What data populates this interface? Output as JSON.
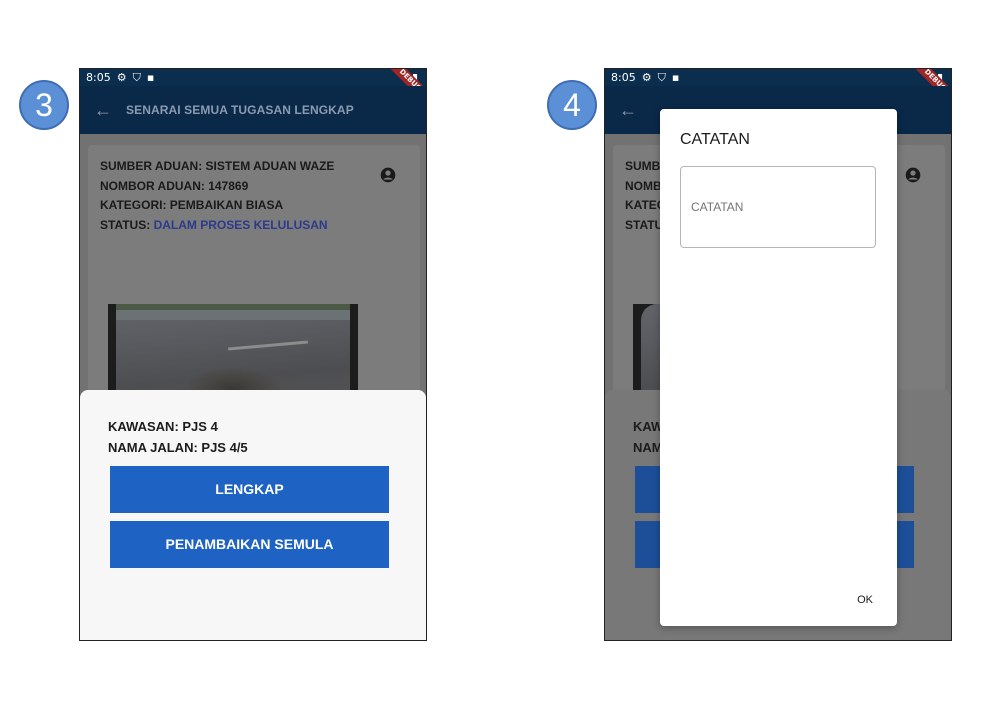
{
  "steps": [
    "3",
    "4"
  ],
  "statusbar": {
    "time": "8:05",
    "debug": "DEBUG"
  },
  "screen3": {
    "appbar_title": "SENARAI SEMUA TUGASAN LENGKAP",
    "card": {
      "sumber": "SUMBER ADUAN: SISTEM ADUAN WAZE",
      "nombor": "NOMBOR ADUAN: 147869",
      "kategori": "KATEGORI: PEMBAIKAN BIASA",
      "status_label": "STATUS: ",
      "status_value": "DALAM PROSES KELULUSAN"
    },
    "sheet": {
      "kawasan": "KAWASAN: PJS 4",
      "nama_jalan": "NAMA JALAN: PJS 4/5",
      "btn_lengkap": "LENGKAP",
      "btn_penambaikan": "PENAMBAIKAN SEMULA"
    }
  },
  "screen4": {
    "card_partial": [
      "SUMBE",
      "NOMB",
      "KATEG",
      "STATU"
    ],
    "sheet_partial": [
      "KAW",
      "NAM"
    ],
    "dialog": {
      "title": "CATATAN",
      "field_placeholder": "CATATAN",
      "ok": "OK"
    }
  },
  "colors": {
    "appbar": "#0a2848",
    "button": "#1e63c3",
    "status_value": "#2c3a8c",
    "badge": "#5b8fd6"
  }
}
